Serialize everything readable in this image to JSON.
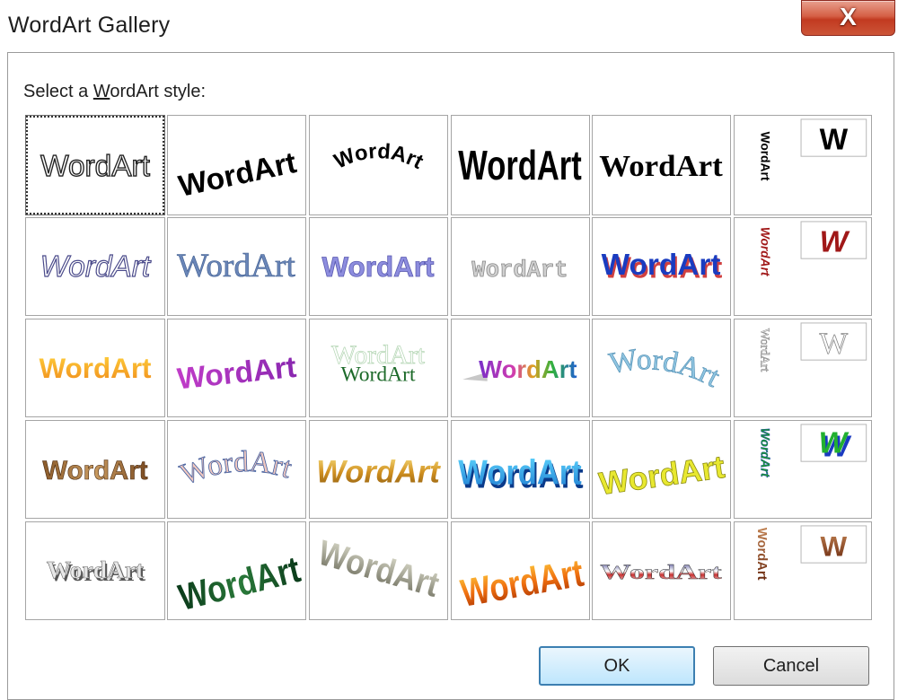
{
  "window": {
    "title": "WordArt Gallery",
    "close_label": "X"
  },
  "prompt": {
    "before": "Select a ",
    "accel": "W",
    "after": "ordArt style:"
  },
  "gallery": {
    "word": "WordArt",
    "vertical_letter": "W",
    "selected_index": 0
  },
  "buttons": {
    "ok": "OK",
    "cancel": "Cancel"
  },
  "colors": {
    "accent_ok_border": "#3c7fb1",
    "close_red": "#c23a20"
  }
}
